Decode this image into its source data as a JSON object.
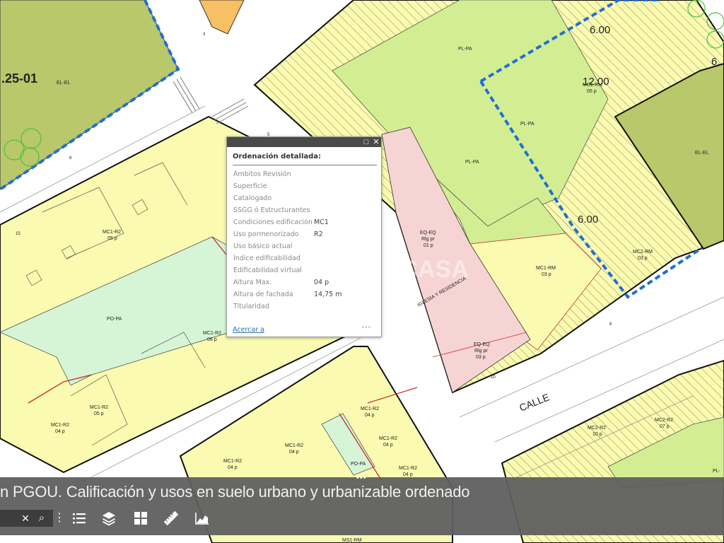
{
  "app": {
    "title": "n PGOU. Calificación y usos en suelo urbano y urbanizable ordenado"
  },
  "map": {
    "labels": {
      "code_25_01": ".25-01",
      "el_el_left": "EL-EL",
      "el_el_right": "EL-EL",
      "pl_pa_top": "PL-PA",
      "pl_pa_mid": "PL-PA",
      "pl_pa_small": "PL-PA",
      "pl_pa_edge": "PL-",
      "po_pa": "PO-PA",
      "po_pa_small": "PO-PA",
      "mc1_r2_a": "MC1-R2",
      "mc1_r2_a_p": "05 p",
      "mc1_r2_b": "MC1-R2",
      "mc1_r2_b_p": "06 p",
      "mc1_r2_c": "MC1-R2",
      "mc1_r2_c_p": "05 p",
      "mc1_r2_d": "MC1-R2",
      "mc1_r2_d_p": "04 p",
      "mc1_r2_e": "MC1-R2",
      "mc1_r2_e_p": "04 p",
      "mc1_r2_f": "MC1-R2",
      "mc1_r2_f_p": "04 p",
      "mc1_r2_g": "MC1-R2",
      "mc1_r2_g_p": "04 p",
      "mc1_r2_h": "MC1-R2",
      "mc1_r2_h_p": "04 p",
      "mc1_r2_i": "MC1-R2",
      "mc1_r2_i_p": "04 p",
      "mc1_rm_top": "MC1-RM",
      "mc1_rm_top_p": "05 p",
      "mc1_rm": "MC1-RM",
      "mc1_rm_p": "03 p",
      "mc2_rm": "MC2-RM",
      "mc2_rm_p": "03 p",
      "mc2_r2_a": "MC2-R2",
      "mc2_r2_a_p": "10 p",
      "mc2_r2_b": "MC2-R2",
      "mc2_r2_b_p": "07 p",
      "ms1_rm": "MS1-RM",
      "eq_eq_1": "EQ-EQ",
      "eq_eq_1_b": "Rlg pr",
      "eq_eq_1_p": "01 p",
      "eq_eq_2": "EQ-EQ",
      "eq_eq_2_b": "Rlg pr",
      "eq_eq_2_p": "03 p",
      "iglesia": "IGLESIA Y RESIDENCIA",
      "calle": "CALLE",
      "dim_6_top": "6.00",
      "dim_12": "12.00",
      "dim_6_mid": "6.00",
      "dim_6_edge": "6.",
      "num_3": "3",
      "num_5": "5",
      "num_6": "6",
      "num_8": "8",
      "num_10": "10",
      "num_15": "15",
      "watermark": "OCASA"
    }
  },
  "popup": {
    "title": "Ordenación detallada:",
    "fields": [
      {
        "label": "Ámbitos Revisión",
        "value": ""
      },
      {
        "label": "Superficie",
        "value": ""
      },
      {
        "label": "Catalogado",
        "value": ""
      },
      {
        "label": "SSGG ó Estructurantes",
        "value": ""
      },
      {
        "label": "Condiciones edificación",
        "value": "MC1"
      },
      {
        "label": "Uso pormenorizado",
        "value": "R2"
      },
      {
        "label": "Uso básico actual",
        "value": ""
      },
      {
        "label": "Índice edificabilidad",
        "value": ""
      },
      {
        "label": "Edificabilidad virtual",
        "value": ""
      },
      {
        "label": "Altura Max.",
        "value": "04 p"
      },
      {
        "label": "Altura de fachada",
        "value": "14,75 m"
      },
      {
        "label": "Titularidad",
        "value": ""
      }
    ],
    "zoom_link": "Acercar a",
    "more": "•••",
    "maximize_glyph": "□",
    "close_glyph": "✕"
  },
  "toolbar": {
    "clear_glyph": "✕",
    "search_glyph": "⌕",
    "more_glyph": "⋮",
    "handle": "•••"
  },
  "colors": {
    "zone_yellow": "#fafab0",
    "zone_green_light": "#d3ee92",
    "zone_green_olive": "#b8c86a",
    "zone_pink": "#f7d4d4",
    "zone_mint": "#d6f5d6",
    "boundary_blue": "#1f6fd6"
  }
}
